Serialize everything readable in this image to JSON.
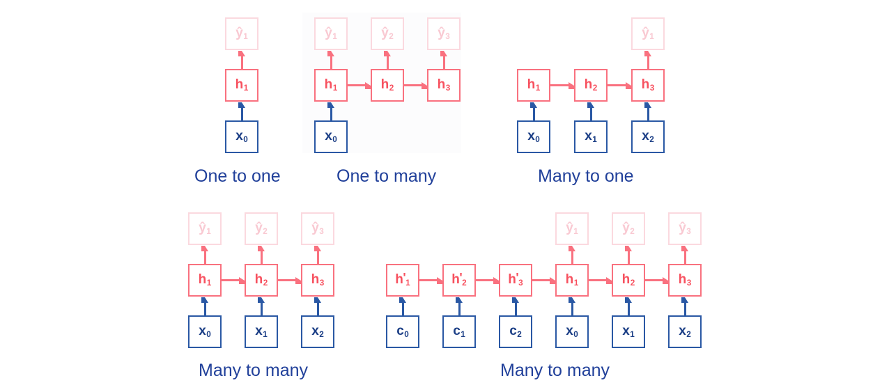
{
  "figure": {
    "title": "RNN architecture types",
    "background_color": "#ffffff",
    "colors": {
      "input_border": "#2a58a4",
      "input_text": "#1c3f86",
      "hidden_border": "#f9717f",
      "hidden_text": "#f7515f",
      "output_border": "#fbd9df",
      "output_text": "#f9c9d2",
      "caption_text": "#21409a",
      "arrow_blue": "#2a58a4",
      "arrow_pink": "#f9717f"
    }
  },
  "diagrams": [
    {
      "id": "one-to-one",
      "caption": "One to one",
      "inputs": [
        {
          "base": "x",
          "sub": "0"
        }
      ],
      "hidden": [
        {
          "base": "h",
          "sub": "1",
          "prime": false
        }
      ],
      "outputs": [
        {
          "base": "ŷ",
          "sub": "1"
        }
      ]
    },
    {
      "id": "one-to-many",
      "caption": "One to many",
      "inputs": [
        {
          "base": "x",
          "sub": "0"
        }
      ],
      "hidden": [
        {
          "base": "h",
          "sub": "1",
          "prime": false
        },
        {
          "base": "h",
          "sub": "2",
          "prime": false
        },
        {
          "base": "h",
          "sub": "3",
          "prime": false
        }
      ],
      "outputs": [
        {
          "base": "ŷ",
          "sub": "1"
        },
        {
          "base": "ŷ",
          "sub": "2"
        },
        {
          "base": "ŷ",
          "sub": "3"
        }
      ]
    },
    {
      "id": "many-to-one",
      "caption": "Many to one",
      "inputs": [
        {
          "base": "x",
          "sub": "0"
        },
        {
          "base": "x",
          "sub": "1"
        },
        {
          "base": "x",
          "sub": "2"
        }
      ],
      "hidden": [
        {
          "base": "h",
          "sub": "1",
          "prime": false
        },
        {
          "base": "h",
          "sub": "2",
          "prime": false
        },
        {
          "base": "h",
          "sub": "3",
          "prime": false
        }
      ],
      "outputs": [
        {
          "base": "ŷ",
          "sub": "1"
        }
      ]
    },
    {
      "id": "many-to-many",
      "caption": "Many to many",
      "inputs": [
        {
          "base": "x",
          "sub": "0"
        },
        {
          "base": "x",
          "sub": "1"
        },
        {
          "base": "x",
          "sub": "2"
        }
      ],
      "hidden": [
        {
          "base": "h",
          "sub": "1",
          "prime": false
        },
        {
          "base": "h",
          "sub": "2",
          "prime": false
        },
        {
          "base": "h",
          "sub": "3",
          "prime": false
        }
      ],
      "outputs": [
        {
          "base": "ŷ",
          "sub": "1"
        },
        {
          "base": "ŷ",
          "sub": "2"
        },
        {
          "base": "ŷ",
          "sub": "3"
        }
      ]
    },
    {
      "id": "many-to-many-encoder-decoder",
      "caption": "Many to many",
      "inputs": [
        {
          "base": "c",
          "sub": "0"
        },
        {
          "base": "c",
          "sub": "1"
        },
        {
          "base": "c",
          "sub": "2"
        },
        {
          "base": "x",
          "sub": "0"
        },
        {
          "base": "x",
          "sub": "1"
        },
        {
          "base": "x",
          "sub": "2"
        }
      ],
      "hidden": [
        {
          "base": "h",
          "sub": "1",
          "prime": true
        },
        {
          "base": "h",
          "sub": "2",
          "prime": true
        },
        {
          "base": "h",
          "sub": "3",
          "prime": true
        },
        {
          "base": "h",
          "sub": "1",
          "prime": false
        },
        {
          "base": "h",
          "sub": "2",
          "prime": false
        },
        {
          "base": "h",
          "sub": "3",
          "prime": false
        }
      ],
      "outputs": [
        {
          "base": "ŷ",
          "sub": "1"
        },
        {
          "base": "ŷ",
          "sub": "2"
        },
        {
          "base": "ŷ",
          "sub": "3"
        }
      ]
    }
  ]
}
